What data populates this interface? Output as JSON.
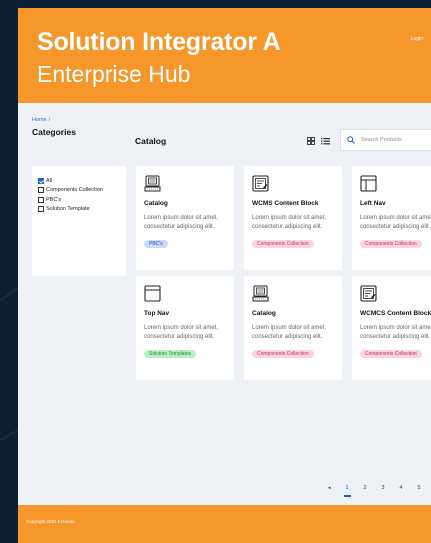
{
  "header": {
    "brand_line1": "Solution Integrator A",
    "brand_line2": "Enterprise Hub",
    "login_label": "Login"
  },
  "breadcrumb": {
    "home": "Home",
    "separator": "/"
  },
  "sidebar": {
    "title": "Categories",
    "items": [
      {
        "label": "All",
        "checked": true
      },
      {
        "label": "Components Collection",
        "checked": false
      },
      {
        "label": "PBC's",
        "checked": false
      },
      {
        "label": "Solution Template",
        "checked": false
      }
    ]
  },
  "main": {
    "title": "Catalog",
    "view_icons": [
      "grid-view-icon",
      "list-view-icon"
    ],
    "search": {
      "placeholder": "Search Products",
      "value": ""
    }
  },
  "cards": [
    {
      "title": "Catalog",
      "desc1": "Lorem ipsum dolor sit amet,",
      "desc2": "consectetur adipiscing elit.",
      "tag": "PBC's",
      "tag_color": "blue",
      "icon": "catalog-icon"
    },
    {
      "title": "WCMS Content Block",
      "desc1": "Lorem ipsum dolor sit amet,",
      "desc2": "consectetur adipiscing elit.",
      "tag": "Components Collection",
      "tag_color": "pink",
      "icon": "content-block-icon"
    },
    {
      "title": "Left Nav",
      "desc1": "Lorem ipsum dolor sit amet,",
      "desc2": "consectetur adipiscing elit.",
      "tag": "Components Collection",
      "tag_color": "pink",
      "icon": "left-nav-icon"
    },
    {
      "title": "Top Nav",
      "desc1": "Lorem ipsum dolor sit amet,",
      "desc2": "consectetur adipiscing elit.",
      "tag": "Solution Templates",
      "tag_color": "green",
      "icon": "top-nav-icon"
    },
    {
      "title": "Catalog",
      "desc1": "Lorem ipsum dolor sit amet,",
      "desc2": "consectetur adipiscing elit.",
      "tag": "Components Collection",
      "tag_color": "pink",
      "icon": "catalog-icon"
    },
    {
      "title": "WCMCS Content Block",
      "desc1": "Lorem ipsum dolor sit amet,",
      "desc2": "consectetur adipiscing elit.",
      "tag": "Components Collection",
      "tag_color": "pink",
      "icon": "content-block-icon"
    }
  ],
  "pagination": {
    "prev": "◂",
    "pages": [
      "1",
      "2",
      "3",
      "4",
      "5"
    ],
    "current": "1"
  },
  "footer": {
    "copyright": "Copyright 2021 Entando"
  },
  "colors": {
    "brand_orange": "#f6972b",
    "accent_blue": "#1c5cc5",
    "page_bg": "#eef1f6",
    "frame_bg": "#0d2033"
  }
}
